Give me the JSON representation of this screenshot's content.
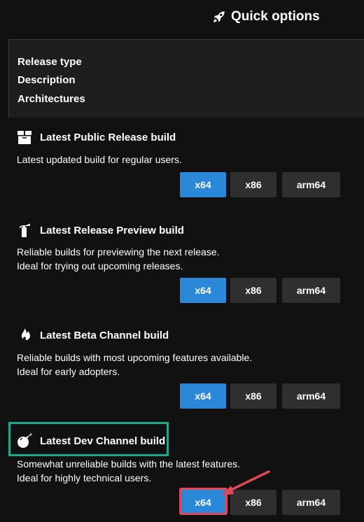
{
  "header": {
    "title": "Quick options",
    "icon": "rocket-icon"
  },
  "table_header": {
    "release_type": "Release type",
    "description": "Description",
    "architectures": "Architectures"
  },
  "sections": [
    {
      "title": "Latest Public Release build",
      "icon": "box-icon",
      "description_lines": [
        "Latest updated build for regular users."
      ],
      "buttons": [
        "x64",
        "x86",
        "arm64"
      ]
    },
    {
      "title": "Latest Release Preview build",
      "icon": "fire-extinguisher-icon",
      "description_lines": [
        "Reliable builds for previewing the next release.",
        "Ideal for trying out upcoming releases."
      ],
      "buttons": [
        "x64",
        "x86",
        "arm64"
      ]
    },
    {
      "title": "Latest Beta Channel build",
      "icon": "flame-icon",
      "description_lines": [
        "Reliable builds with most upcoming features available.",
        "Ideal for early adopters."
      ],
      "buttons": [
        "x64",
        "x86",
        "arm64"
      ]
    },
    {
      "title": "Latest Dev Channel build",
      "icon": "bomb-icon",
      "description_lines": [
        "Somewhat unreliable builds with the latest features.",
        "Ideal for highly technical users."
      ],
      "buttons": [
        "x64",
        "x86",
        "arm64"
      ]
    }
  ],
  "colors": {
    "background": "#111111",
    "header_panel": "#1e1e1e",
    "primary_button": "#2b87d8",
    "secondary_button": "#2f2f2f",
    "highlight_box": "#1ea88f",
    "highlight_arrow": "#e0485a"
  }
}
